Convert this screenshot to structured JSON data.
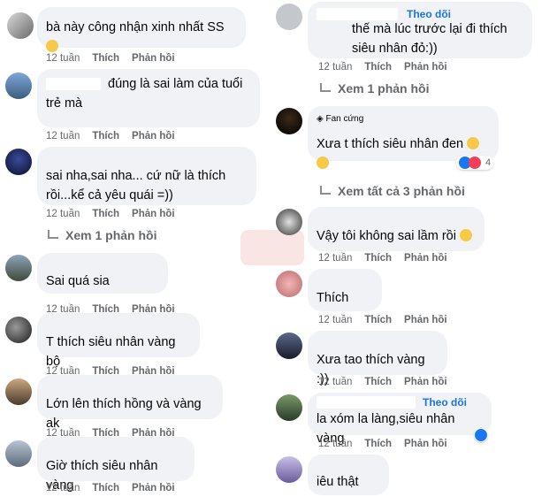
{
  "labels": {
    "week": "12 tuần",
    "like": "Thích",
    "reply": "Phản hồi"
  },
  "left": [
    {
      "text": "bà này công nhận xinh nhất SS",
      "has_emoji": true
    },
    {
      "name_fragment": "đúng là sai làm của tuổi",
      "text": "trẻ mà"
    },
    {
      "text": "sai nha,sai nha... cứ nữ là thích rồi...kể cả yêu quái =))",
      "view_replies": "Xem 1 phản hồi"
    },
    {
      "text": "Sai quá sia"
    },
    {
      "text": "T thích siêu nhân vàng bộ"
    },
    {
      "text": "Lớn lên thích hồng và vàng ak"
    },
    {
      "text": "Giờ thích siêu nhân vàng"
    }
  ],
  "right": [
    {
      "follow": "Theo dõi",
      "text": "thế mà lúc trước lại đi thích siêu nhân đỏ:))",
      "view_replies": "Xem 1 phản hồi"
    },
    {
      "badge": "Fan cứng",
      "text": "Xưa t thích siêu nhân đen",
      "reaction_count": "4",
      "view_replies": "Xem tất cả 3 phản hồi"
    },
    {
      "text": "Vậy tôi không sai lầm rồi"
    },
    {
      "text": "Thích"
    },
    {
      "text": "Xưa tao thích vàng :))"
    },
    {
      "follow": "Theo dõi",
      "text": "la xóm la làng,siêu nhân vàng"
    },
    {
      "text": "iêu thật"
    }
  ],
  "colors": {
    "bubble": "#f0f2f5",
    "meta": "#65676b",
    "link": "#1b74e4",
    "like": "#1877f2",
    "love": "#f33e58"
  }
}
